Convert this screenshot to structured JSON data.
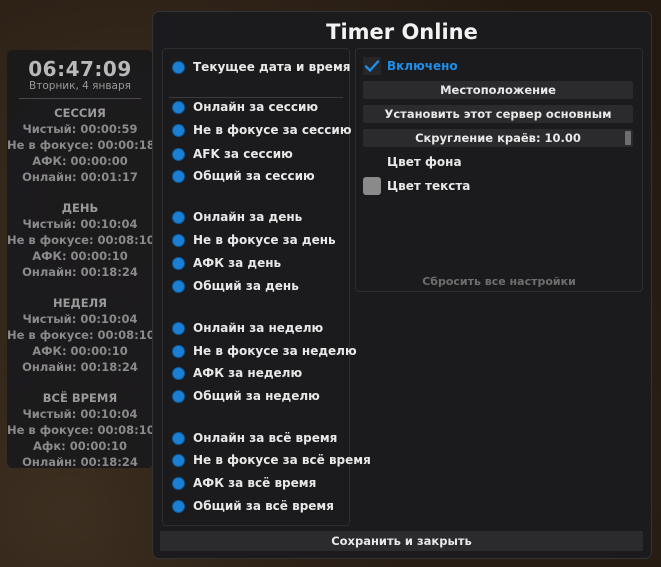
{
  "stats": {
    "clock": "06:47:09",
    "date": "Вторник, 4 января",
    "sections": [
      {
        "title": "СЕССИЯ",
        "lines": [
          "Чистый: 00:00:59",
          "Не в фокусе: 00:00:18",
          "АФК: 00:00:00",
          "Онлайн: 00:01:17"
        ]
      },
      {
        "title": "ДЕНЬ",
        "lines": [
          "Чистый: 00:10:04",
          "Не в фокусе: 00:08:10",
          "АФК: 00:00:10",
          "Онлайн: 00:18:24"
        ]
      },
      {
        "title": "НЕДЕЛЯ",
        "lines": [
          "Чистый: 00:10:04",
          "Не в фокусе: 00:08:10",
          "АФК: 00:00:10",
          "Онлайн: 00:18:24"
        ]
      },
      {
        "title": "ВСЁ ВРЕМЯ",
        "lines": [
          "Чистый: 00:10:04",
          "Не в фокусе: 00:08:10",
          "Афк: 00:00:10",
          "Онлайн: 00:18:24"
        ]
      }
    ]
  },
  "window": {
    "title": "Timer Online",
    "options": [
      "Текущее дата и время",
      "Онлайн за сессию",
      "Не в фокусе за сессию",
      "AFK за сессию",
      "Общий за сессию",
      "Онлайн за день",
      "Не в фокусе за день",
      "АФК за день",
      "Общий за день",
      "Онлайн за неделю",
      "Не в фокусе за неделю",
      "АФК за неделю",
      "Общий за неделю",
      "Онлайн за всё время",
      "Не в фокусе за всё время",
      "АФК за всё время",
      "Общий за всё время"
    ],
    "settings": {
      "enabled_label": "Включено",
      "location_button": "Местоположение",
      "main_server_button": "Установить этот сервер основным",
      "rounding_slider": "Скругление краёв: 10.00",
      "rounding_value": 10,
      "bg_color_label": "Цвет фона",
      "bg_color": "#1b1b1d",
      "text_color_label": "Цвет текста",
      "text_color": "#8a8a8a",
      "reset_label": "Сбросить все настройки"
    },
    "save_button": "Сохранить и закрыть",
    "accent_color": "#1b7fd4"
  }
}
